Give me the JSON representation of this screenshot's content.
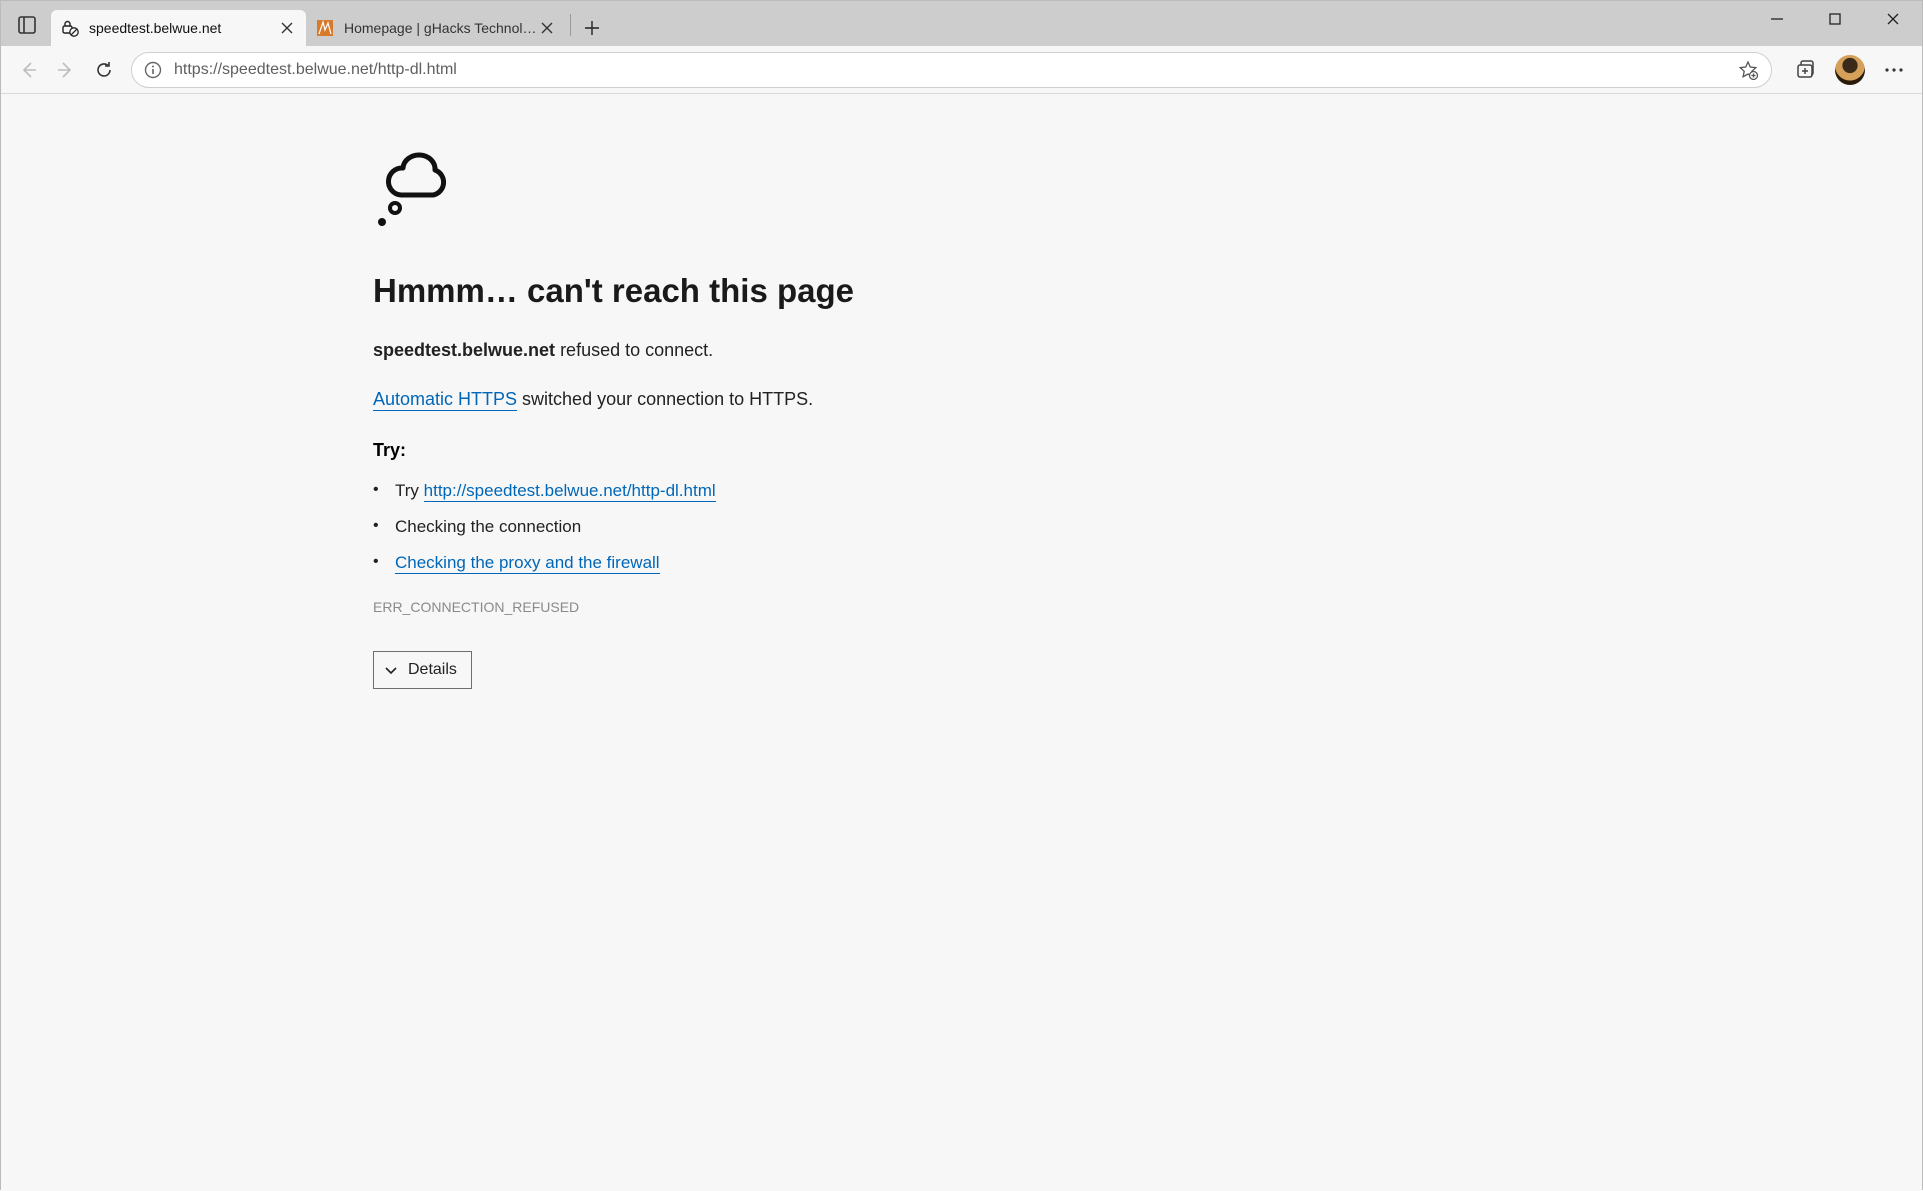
{
  "tabs": [
    {
      "title": "speedtest.belwue.net",
      "active": true
    },
    {
      "title": "Homepage | gHacks Technology",
      "active": false
    }
  ],
  "address_bar": {
    "url_display": "https://speedtest.belwue.net/http-dl.html"
  },
  "error_page": {
    "heading": "Hmmm… can't reach this page",
    "host_bold": "speedtest.belwue.net",
    "refused_text": " refused to connect.",
    "auto_https_link": "Automatic HTTPS",
    "auto_https_rest": " switched your connection to HTTPS.",
    "try_heading": "Try:",
    "try_items": {
      "item1_prefix": "Try ",
      "item1_link": "http://speedtest.belwue.net/http-dl.html",
      "item2": "Checking the connection",
      "item3_link": "Checking the proxy and the firewall"
    },
    "error_code": "ERR_CONNECTION_REFUSED",
    "details_label": "Details"
  }
}
